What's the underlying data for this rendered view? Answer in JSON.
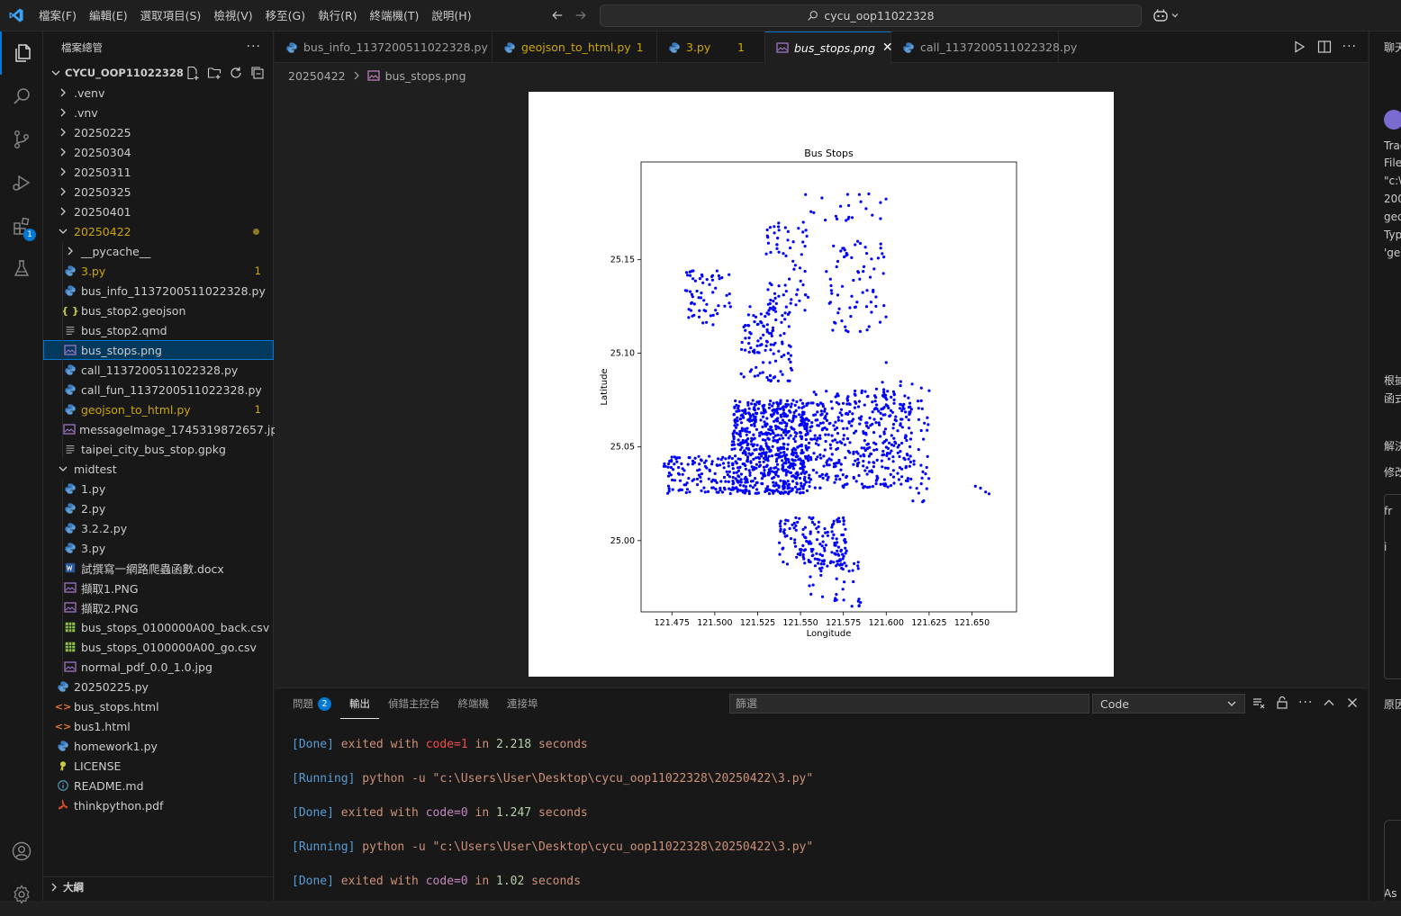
{
  "menu": [
    "檔案(F)",
    "編輯(E)",
    "選取項目(S)",
    "檢視(V)",
    "移至(G)",
    "執行(R)",
    "終端機(T)",
    "說明(H)"
  ],
  "command_center": {
    "text": "cycu_oop11022328"
  },
  "activity": {
    "extensions_badge": "1"
  },
  "sidebar": {
    "title": "檔案總管",
    "more": "···",
    "root": "CYCU_OOP11022328",
    "items": [
      {
        "label": ".venv",
        "kind": "folder-closed",
        "depth": 0
      },
      {
        "label": ".vnv",
        "kind": "folder-closed",
        "depth": 0
      },
      {
        "label": "20250225",
        "kind": "folder-closed",
        "depth": 0
      },
      {
        "label": "20250304",
        "kind": "folder-closed",
        "depth": 0
      },
      {
        "label": "20250311",
        "kind": "folder-closed",
        "depth": 0
      },
      {
        "label": "20250325",
        "kind": "folder-closed",
        "depth": 0
      },
      {
        "label": "20250401",
        "kind": "folder-closed",
        "depth": 0
      },
      {
        "label": "20250422",
        "kind": "folder-open",
        "depth": 0,
        "warn": true,
        "dot": true
      },
      {
        "label": "__pycache__",
        "kind": "folder-closed",
        "depth": 1
      },
      {
        "label": "3.py",
        "kind": "py",
        "depth": 1,
        "warn": true,
        "badge": "1"
      },
      {
        "label": "bus_info_1137200511022328.py",
        "kind": "py",
        "depth": 1
      },
      {
        "label": "bus_stop2.geojson",
        "kind": "json",
        "depth": 1
      },
      {
        "label": "bus_stop2.qmd",
        "kind": "text",
        "depth": 1
      },
      {
        "label": "bus_stops.png",
        "kind": "img",
        "depth": 1,
        "selected": true
      },
      {
        "label": "call_1137200511022328.py",
        "kind": "py",
        "depth": 1
      },
      {
        "label": "call_fun_1137200511022328.py",
        "kind": "py",
        "depth": 1
      },
      {
        "label": "geojson_to_html.py",
        "kind": "py",
        "depth": 1,
        "warn": true,
        "badge": "1"
      },
      {
        "label": "messageImage_1745319872657.jpg",
        "kind": "img",
        "depth": 1
      },
      {
        "label": "taipei_city_bus_stop.gpkg",
        "kind": "text",
        "depth": 1
      },
      {
        "label": "midtest",
        "kind": "folder-open",
        "depth": 0
      },
      {
        "label": "1.py",
        "kind": "py",
        "depth": 1
      },
      {
        "label": "2.py",
        "kind": "py",
        "depth": 1
      },
      {
        "label": "3.2.2.py",
        "kind": "py",
        "depth": 1
      },
      {
        "label": "3.py",
        "kind": "py",
        "depth": 1
      },
      {
        "label": "試撰寫一網路爬蟲函數.docx",
        "kind": "docx",
        "depth": 1
      },
      {
        "label": "擷取1.PNG",
        "kind": "img",
        "depth": 1
      },
      {
        "label": "擷取2.PNG",
        "kind": "img",
        "depth": 1
      },
      {
        "label": "bus_stops_0100000A00_back.csv",
        "kind": "csv",
        "depth": 1
      },
      {
        "label": "bus_stops_0100000A00_go.csv",
        "kind": "csv",
        "depth": 1
      },
      {
        "label": "normal_pdf_0.0_1.0.jpg",
        "kind": "img",
        "depth": 1
      },
      {
        "label": "20250225.py",
        "kind": "py",
        "depth": 0
      },
      {
        "label": "bus_stops.html",
        "kind": "html",
        "depth": 0
      },
      {
        "label": "bus1.html",
        "kind": "html",
        "depth": 0
      },
      {
        "label": "homework1.py",
        "kind": "py",
        "depth": 0
      },
      {
        "label": "LICENSE",
        "kind": "license",
        "depth": 0
      },
      {
        "label": "README.md",
        "kind": "info",
        "depth": 0
      },
      {
        "label": "thinkpython.pdf",
        "kind": "pdf",
        "depth": 0
      }
    ],
    "outline": "大綱"
  },
  "tabs": [
    {
      "label": "bus_info_1137200511022328.py",
      "kind": "py"
    },
    {
      "label": "geojson_to_html.py",
      "kind": "py",
      "warn": true,
      "badge": "1"
    },
    {
      "label": "3.py",
      "kind": "py",
      "warn": true,
      "badge": "1"
    },
    {
      "label": "bus_stops.png",
      "kind": "img",
      "active": true
    },
    {
      "label": "call_1137200511022328.py",
      "kind": "py"
    }
  ],
  "breadcrumb": {
    "folder": "20250422",
    "file": "bus_stops.png"
  },
  "chart_data": {
    "type": "scatter",
    "title": "Bus Stops",
    "xlabel": "Longitude",
    "ylabel": "Latitude",
    "xlim": [
      121.457,
      121.676
    ],
    "ylim": [
      24.962,
      25.202
    ],
    "xticks": [
      "121.475",
      "121.500",
      "121.525",
      "121.550",
      "121.575",
      "121.600",
      "121.625",
      "121.650"
    ],
    "yticks": [
      "25.00",
      "25.05",
      "25.10",
      "25.15"
    ],
    "color": "#0000ff",
    "series": [
      {
        "clusters": [
          {
            "x": [
              121.51,
              121.555
            ],
            "y": [
              25.025,
              25.075
            ],
            "n": 700
          },
          {
            "x": [
              121.555,
              121.615
            ],
            "y": [
              25.028,
              25.08
            ],
            "n": 380
          },
          {
            "x": [
              121.47,
              121.51
            ],
            "y": [
              25.025,
              25.045
            ],
            "n": 120
          },
          {
            "x": [
              121.537,
              121.577
            ],
            "y": [
              24.985,
              25.013
            ],
            "n": 150
          },
          {
            "x": [
              121.555,
              121.585
            ],
            "y": [
              24.965,
              24.99
            ],
            "n": 35
          },
          {
            "x": [
              121.515,
              121.545
            ],
            "y": [
              25.085,
              25.125
            ],
            "n": 110
          },
          {
            "x": [
              121.53,
              121.555
            ],
            "y": [
              25.12,
              25.17
            ],
            "n": 70
          },
          {
            "x": [
              121.482,
              121.51
            ],
            "y": [
              25.115,
              25.145
            ],
            "n": 60
          },
          {
            "x": [
              121.565,
              121.6
            ],
            "y": [
              25.11,
              25.16
            ],
            "n": 70
          },
          {
            "x": [
              121.548,
              121.6
            ],
            "y": [
              25.17,
              25.185
            ],
            "n": 22
          },
          {
            "x": [
              121.59,
              121.625
            ],
            "y": [
              25.03,
              25.085
            ],
            "n": 55
          },
          {
            "x": [
              121.615,
              121.625
            ],
            "y": [
              25.02,
              25.045
            ],
            "n": 12
          }
        ],
        "points": [
          [
            121.655,
            25.028
          ],
          [
            121.658,
            25.026
          ],
          [
            121.652,
            25.029
          ],
          [
            121.66,
            25.025
          ],
          [
            121.625,
            25.08
          ],
          [
            121.6,
            25.095
          ],
          [
            121.594,
            25.13
          ],
          [
            121.57,
            24.968
          ],
          [
            121.585,
            24.967
          ],
          [
            121.58,
            24.965
          ]
        ]
      }
    ]
  },
  "panel": {
    "tabs": [
      "問題",
      "輸出",
      "偵錯主控台",
      "終端機",
      "連接埠"
    ],
    "problems_badge": "2",
    "filter_placeholder": "篩選",
    "channel": "Code",
    "output": [
      {
        "done": true,
        "pre": "[Done]",
        "mid": " exited with ",
        "code": "code=1",
        "in": " in ",
        "time": "2.218",
        "sec": " seconds"
      },
      {
        "done": false,
        "pre": "[Running]",
        "cmd": " python -u \"c:\\Users\\User\\Desktop\\cycu_oop11022328\\20250422\\3.py\""
      },
      {
        "done": true,
        "pre": "[Done]",
        "mid": " exited with ",
        "code": "code=0",
        "in": " in ",
        "time": "1.247",
        "sec": " seconds"
      },
      {
        "done": false,
        "pre": "[Running]",
        "cmd": " python -u \"c:\\Users\\User\\Desktop\\cycu_oop11022328\\20250422\\3.py\""
      },
      {
        "done": true,
        "pre": "[Done]",
        "mid": " exited with ",
        "code": "code=0",
        "in": " in ",
        "time": "1.02",
        "sec": " seconds"
      }
    ]
  },
  "right": {
    "lines": [
      "聊天",
      "Trac",
      "File",
      "\"c:\\",
      "200",
      "geo",
      "Typ",
      "'ge",
      "根據",
      "函式",
      "解決",
      "修改",
      "fr",
      "i",
      "原因",
      "As"
    ]
  }
}
